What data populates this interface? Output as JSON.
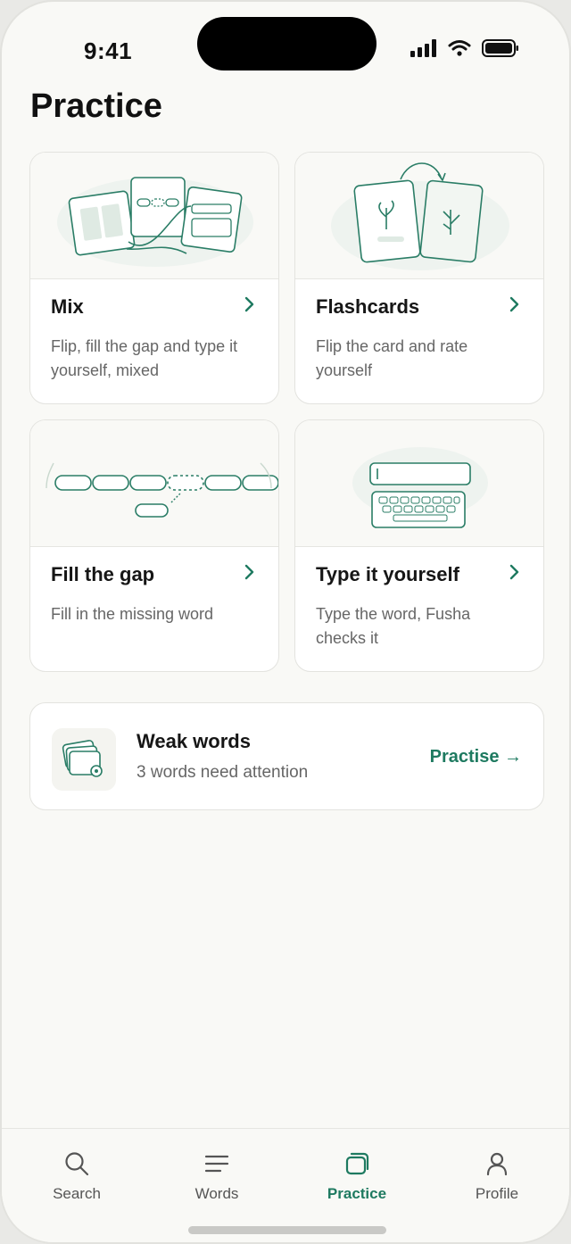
{
  "status_bar": {
    "time": "9:41"
  },
  "page": {
    "title": "Practice"
  },
  "cards": [
    {
      "title": "Mix",
      "description": "Flip, fill the gap and type it yourself, mixed"
    },
    {
      "title": "Flashcards",
      "description": "Flip the card and rate yourself"
    },
    {
      "title": "Fill the gap",
      "description": "Fill in the missing word"
    },
    {
      "title": "Type it yourself",
      "description": "Type the word, Fusha checks it"
    }
  ],
  "weak_words": {
    "title": "Weak words",
    "subtitle": "3 words need attention",
    "action_label": "Practise →"
  },
  "tabbar": {
    "tabs": [
      {
        "label": "Search",
        "icon": "search-icon"
      },
      {
        "label": "Words",
        "icon": "list-icon"
      },
      {
        "label": "Practice",
        "icon": "cards-icon",
        "active": true
      },
      {
        "label": "Profile",
        "icon": "person-icon"
      }
    ]
  },
  "colors": {
    "accent": "#1e7a60",
    "background": "#f9f9f6",
    "card": "#ffffff",
    "illustration_stroke": "#2a7d66"
  }
}
